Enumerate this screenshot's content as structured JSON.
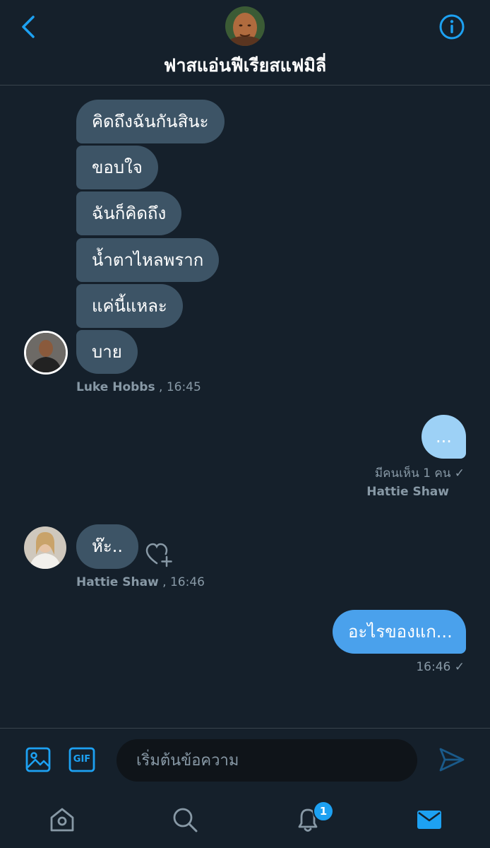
{
  "header": {
    "title": "ฟาสแอ่นฟีเรียสแฟมิลี่",
    "back_icon": "chevron-left-icon",
    "info_icon": "info-icon"
  },
  "conversation": {
    "group1": {
      "messages": [
        "คิดถึงฉันกันสินะ",
        "ขอบใจ",
        "ฉันก็คิดถึง",
        "น้ำตาไหลพราก",
        "แค่นี้แหละ",
        "บาย"
      ],
      "sender": "Luke Hobbs",
      "time": ", 16:45"
    },
    "outgoing1": {
      "message": "...",
      "seen": "มีคนเห็น 1 คน ✓",
      "sender": "Hattie Shaw"
    },
    "group2": {
      "message": "ห๊ะ..",
      "sender": "Hattie Shaw",
      "time": ", 16:46"
    },
    "outgoing2": {
      "message": "อะไรของแก...",
      "time": "16:46 ✓"
    }
  },
  "composer": {
    "placeholder": "เริ่มต้นข้อความ",
    "gif_label": "GIF"
  },
  "nav": {
    "notification_count": "1"
  },
  "colors": {
    "background": "#15202b",
    "incoming_bubble": "#3d5466",
    "outgoing_bubble": "#4aa1ec",
    "accent": "#1da1f2",
    "secondary_text": "#8899a6"
  }
}
